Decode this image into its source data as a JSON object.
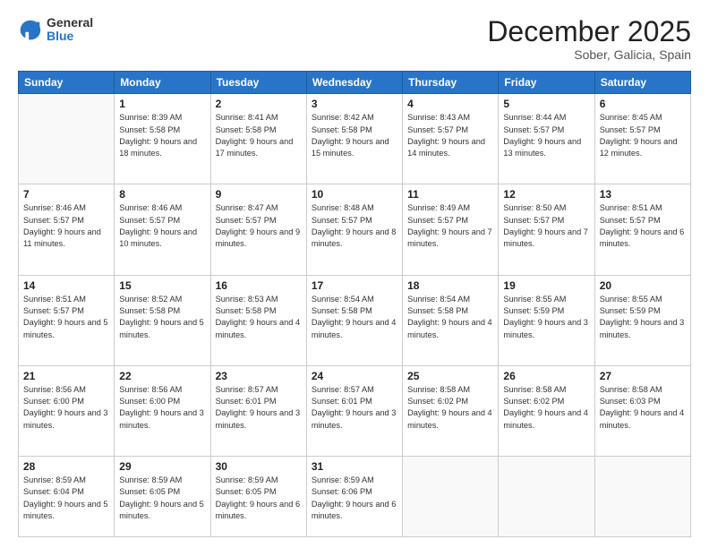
{
  "header": {
    "logo": {
      "general": "General",
      "blue": "Blue"
    },
    "title": "December 2025",
    "subtitle": "Sober, Galicia, Spain"
  },
  "days_of_week": [
    "Sunday",
    "Monday",
    "Tuesday",
    "Wednesday",
    "Thursday",
    "Friday",
    "Saturday"
  ],
  "weeks": [
    [
      {
        "day": "",
        "empty": true
      },
      {
        "day": "1",
        "sunrise": "8:39 AM",
        "sunset": "5:58 PM",
        "daylight": "9 hours and 18 minutes."
      },
      {
        "day": "2",
        "sunrise": "8:41 AM",
        "sunset": "5:58 PM",
        "daylight": "9 hours and 17 minutes."
      },
      {
        "day": "3",
        "sunrise": "8:42 AM",
        "sunset": "5:58 PM",
        "daylight": "9 hours and 15 minutes."
      },
      {
        "day": "4",
        "sunrise": "8:43 AM",
        "sunset": "5:57 PM",
        "daylight": "9 hours and 14 minutes."
      },
      {
        "day": "5",
        "sunrise": "8:44 AM",
        "sunset": "5:57 PM",
        "daylight": "9 hours and 13 minutes."
      },
      {
        "day": "6",
        "sunrise": "8:45 AM",
        "sunset": "5:57 PM",
        "daylight": "9 hours and 12 minutes."
      }
    ],
    [
      {
        "day": "7",
        "sunrise": "8:46 AM",
        "sunset": "5:57 PM",
        "daylight": "9 hours and 11 minutes."
      },
      {
        "day": "8",
        "sunrise": "8:46 AM",
        "sunset": "5:57 PM",
        "daylight": "9 hours and 10 minutes."
      },
      {
        "day": "9",
        "sunrise": "8:47 AM",
        "sunset": "5:57 PM",
        "daylight": "9 hours and 9 minutes."
      },
      {
        "day": "10",
        "sunrise": "8:48 AM",
        "sunset": "5:57 PM",
        "daylight": "9 hours and 8 minutes."
      },
      {
        "day": "11",
        "sunrise": "8:49 AM",
        "sunset": "5:57 PM",
        "daylight": "9 hours and 7 minutes."
      },
      {
        "day": "12",
        "sunrise": "8:50 AM",
        "sunset": "5:57 PM",
        "daylight": "9 hours and 7 minutes."
      },
      {
        "day": "13",
        "sunrise": "8:51 AM",
        "sunset": "5:57 PM",
        "daylight": "9 hours and 6 minutes."
      }
    ],
    [
      {
        "day": "14",
        "sunrise": "8:51 AM",
        "sunset": "5:57 PM",
        "daylight": "9 hours and 5 minutes."
      },
      {
        "day": "15",
        "sunrise": "8:52 AM",
        "sunset": "5:58 PM",
        "daylight": "9 hours and 5 minutes."
      },
      {
        "day": "16",
        "sunrise": "8:53 AM",
        "sunset": "5:58 PM",
        "daylight": "9 hours and 4 minutes."
      },
      {
        "day": "17",
        "sunrise": "8:54 AM",
        "sunset": "5:58 PM",
        "daylight": "9 hours and 4 minutes."
      },
      {
        "day": "18",
        "sunrise": "8:54 AM",
        "sunset": "5:58 PM",
        "daylight": "9 hours and 4 minutes."
      },
      {
        "day": "19",
        "sunrise": "8:55 AM",
        "sunset": "5:59 PM",
        "daylight": "9 hours and 3 minutes."
      },
      {
        "day": "20",
        "sunrise": "8:55 AM",
        "sunset": "5:59 PM",
        "daylight": "9 hours and 3 minutes."
      }
    ],
    [
      {
        "day": "21",
        "sunrise": "8:56 AM",
        "sunset": "6:00 PM",
        "daylight": "9 hours and 3 minutes."
      },
      {
        "day": "22",
        "sunrise": "8:56 AM",
        "sunset": "6:00 PM",
        "daylight": "9 hours and 3 minutes."
      },
      {
        "day": "23",
        "sunrise": "8:57 AM",
        "sunset": "6:01 PM",
        "daylight": "9 hours and 3 minutes."
      },
      {
        "day": "24",
        "sunrise": "8:57 AM",
        "sunset": "6:01 PM",
        "daylight": "9 hours and 3 minutes."
      },
      {
        "day": "25",
        "sunrise": "8:58 AM",
        "sunset": "6:02 PM",
        "daylight": "9 hours and 4 minutes."
      },
      {
        "day": "26",
        "sunrise": "8:58 AM",
        "sunset": "6:02 PM",
        "daylight": "9 hours and 4 minutes."
      },
      {
        "day": "27",
        "sunrise": "8:58 AM",
        "sunset": "6:03 PM",
        "daylight": "9 hours and 4 minutes."
      }
    ],
    [
      {
        "day": "28",
        "sunrise": "8:59 AM",
        "sunset": "6:04 PM",
        "daylight": "9 hours and 5 minutes."
      },
      {
        "day": "29",
        "sunrise": "8:59 AM",
        "sunset": "6:05 PM",
        "daylight": "9 hours and 5 minutes."
      },
      {
        "day": "30",
        "sunrise": "8:59 AM",
        "sunset": "6:05 PM",
        "daylight": "9 hours and 6 minutes."
      },
      {
        "day": "31",
        "sunrise": "8:59 AM",
        "sunset": "6:06 PM",
        "daylight": "9 hours and 6 minutes."
      },
      {
        "day": "",
        "empty": true
      },
      {
        "day": "",
        "empty": true
      },
      {
        "day": "",
        "empty": true
      }
    ]
  ],
  "labels": {
    "sunrise": "Sunrise:",
    "sunset": "Sunset:",
    "daylight": "Daylight:"
  }
}
